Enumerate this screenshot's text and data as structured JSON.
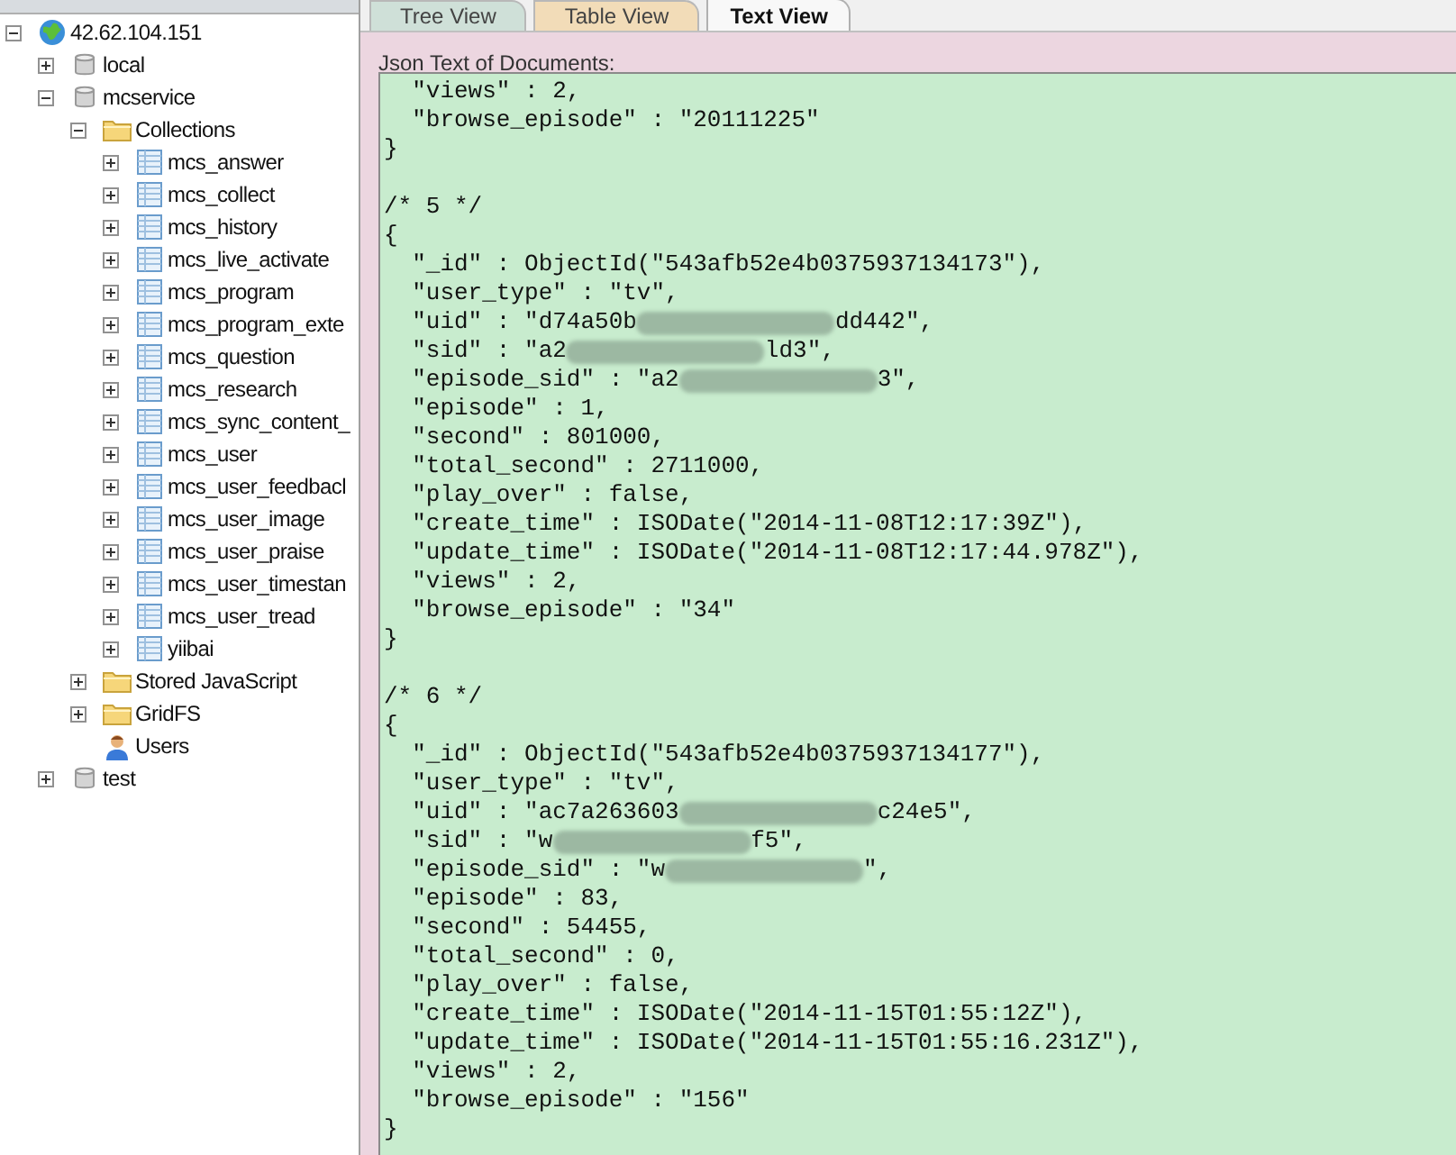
{
  "tree": [
    {
      "label": "42.62.104.151",
      "kind": "server",
      "expanded": true,
      "children": [
        {
          "label": "local",
          "kind": "database",
          "expanded": false
        },
        {
          "label": "mcservice",
          "kind": "database",
          "expanded": true,
          "children": [
            {
              "label": "Collections",
              "kind": "folder",
              "expanded": true,
              "children": [
                {
                  "label": "mcs_answer",
                  "kind": "collection",
                  "expanded": false
                },
                {
                  "label": "mcs_collect",
                  "kind": "collection",
                  "expanded": false
                },
                {
                  "label": "mcs_history",
                  "kind": "collection",
                  "expanded": false
                },
                {
                  "label": "mcs_live_activate",
                  "kind": "collection",
                  "expanded": false
                },
                {
                  "label": "mcs_program",
                  "kind": "collection",
                  "expanded": false
                },
                {
                  "label": "mcs_program_exte",
                  "kind": "collection",
                  "expanded": false
                },
                {
                  "label": "mcs_question",
                  "kind": "collection",
                  "expanded": false
                },
                {
                  "label": "mcs_research",
                  "kind": "collection",
                  "expanded": false
                },
                {
                  "label": "mcs_sync_content_",
                  "kind": "collection",
                  "expanded": false
                },
                {
                  "label": "mcs_user",
                  "kind": "collection",
                  "expanded": false
                },
                {
                  "label": "mcs_user_feedbacl",
                  "kind": "collection",
                  "expanded": false
                },
                {
                  "label": "mcs_user_image",
                  "kind": "collection",
                  "expanded": false
                },
                {
                  "label": "mcs_user_praise",
                  "kind": "collection",
                  "expanded": false
                },
                {
                  "label": "mcs_user_timestan",
                  "kind": "collection",
                  "expanded": false
                },
                {
                  "label": "mcs_user_tread",
                  "kind": "collection",
                  "expanded": false
                },
                {
                  "label": "yiibai",
                  "kind": "collection",
                  "expanded": false
                }
              ]
            },
            {
              "label": "Stored JavaScript",
              "kind": "folder",
              "expanded": false
            },
            {
              "label": "GridFS",
              "kind": "folder",
              "expanded": false
            },
            {
              "label": "Users",
              "kind": "users"
            }
          ]
        },
        {
          "label": "test",
          "kind": "database",
          "expanded": false
        }
      ]
    }
  ],
  "tabs": [
    {
      "label": "Tree View",
      "selected": false
    },
    {
      "label": "Table View",
      "selected": false
    },
    {
      "label": "Text View",
      "selected": true
    }
  ],
  "text_label": "Json Text of Documents:",
  "json_lines": [
    {
      "kind": "code",
      "text": "  \"views\" : 2,"
    },
    {
      "kind": "code",
      "text": "  \"browse_episode\" : \"20111225\""
    },
    {
      "kind": "code",
      "text": "}"
    },
    {
      "kind": "blank"
    },
    {
      "kind": "code",
      "text": "/* 5 */"
    },
    {
      "kind": "code",
      "text": "{"
    },
    {
      "kind": "code",
      "text": "  \"_id\" : ObjectId(\"543afb52e4b0375937134173\"),"
    },
    {
      "kind": "code",
      "text": "  \"user_type\" : \"tv\","
    },
    {
      "kind": "redacted",
      "text": "  \"uid\" : \"d74a50b",
      "after": "dd442\","
    },
    {
      "kind": "redacted",
      "text": "  \"sid\" : \"a2",
      "after": "ld3\","
    },
    {
      "kind": "redacted",
      "text": "  \"episode_sid\" : \"a2",
      "after": "3\","
    },
    {
      "kind": "code",
      "text": "  \"episode\" : 1,"
    },
    {
      "kind": "code",
      "text": "  \"second\" : 801000,"
    },
    {
      "kind": "code",
      "text": "  \"total_second\" : 2711000,"
    },
    {
      "kind": "code",
      "text": "  \"play_over\" : false,"
    },
    {
      "kind": "code",
      "text": "  \"create_time\" : ISODate(\"2014-11-08T12:17:39Z\"),"
    },
    {
      "kind": "code",
      "text": "  \"update_time\" : ISODate(\"2014-11-08T12:17:44.978Z\"),"
    },
    {
      "kind": "code",
      "text": "  \"views\" : 2,"
    },
    {
      "kind": "code",
      "text": "  \"browse_episode\" : \"34\""
    },
    {
      "kind": "code",
      "text": "}"
    },
    {
      "kind": "blank"
    },
    {
      "kind": "code",
      "text": "/* 6 */"
    },
    {
      "kind": "code",
      "text": "{"
    },
    {
      "kind": "code",
      "text": "  \"_id\" : ObjectId(\"543afb52e4b0375937134177\"),"
    },
    {
      "kind": "code",
      "text": "  \"user_type\" : \"tv\","
    },
    {
      "kind": "redacted",
      "text": "  \"uid\" : \"ac7a263603",
      "after": "c24e5\","
    },
    {
      "kind": "redacted",
      "text": "  \"sid\" : \"w",
      "after": "f5\","
    },
    {
      "kind": "redacted",
      "text": "  \"episode_sid\" : \"w",
      "after": "\","
    },
    {
      "kind": "code",
      "text": "  \"episode\" : 83,"
    },
    {
      "kind": "code",
      "text": "  \"second\" : 54455,"
    },
    {
      "kind": "code",
      "text": "  \"total_second\" : 0,"
    },
    {
      "kind": "code",
      "text": "  \"play_over\" : false,"
    },
    {
      "kind": "code",
      "text": "  \"create_time\" : ISODate(\"2014-11-15T01:55:12Z\"),"
    },
    {
      "kind": "code",
      "text": "  \"update_time\" : ISODate(\"2014-11-15T01:55:16.231Z\"),"
    },
    {
      "kind": "code",
      "text": "  \"views\" : 2,"
    },
    {
      "kind": "code",
      "text": "  \"browse_episode\" : \"156\""
    },
    {
      "kind": "code",
      "text": "}"
    }
  ]
}
